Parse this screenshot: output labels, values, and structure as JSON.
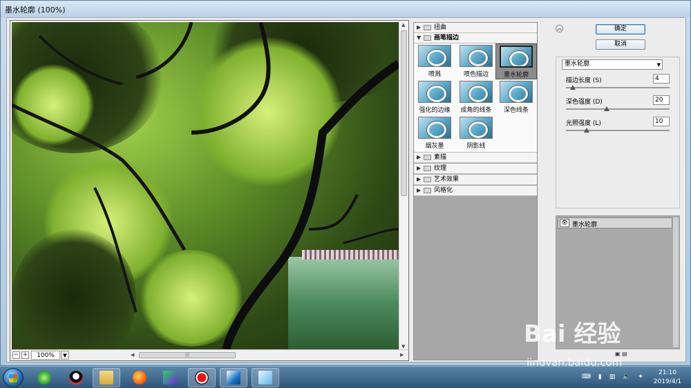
{
  "window": {
    "title": "墨水轮廓 (100%)"
  },
  "preview": {
    "zoom": "100%",
    "zoom_minus": "−",
    "zoom_plus": "+",
    "grip": "|||"
  },
  "gallery": {
    "categories_top": [
      {
        "label": "扭曲"
      }
    ],
    "open_category": {
      "label": "画笔描边"
    },
    "filters": [
      {
        "label": "喷溅"
      },
      {
        "label": "喷色描边"
      },
      {
        "label": "墨水轮廓"
      },
      {
        "label": "强化的边缘"
      },
      {
        "label": "成角的线条"
      },
      {
        "label": "深色线条"
      },
      {
        "label": "烟灰墨"
      },
      {
        "label": "阴影线"
      }
    ],
    "categories_bottom": [
      {
        "label": "素描"
      },
      {
        "label": "纹理"
      },
      {
        "label": "艺术效果"
      },
      {
        "label": "风格化"
      }
    ]
  },
  "buttons": {
    "ok": "确定",
    "cancel": "取消"
  },
  "settings": {
    "filter_select": "墨水轮廓",
    "params": [
      {
        "label": "描边长度 (S)",
        "value": "4",
        "fraction": 0.06
      },
      {
        "label": "深色强度 (D)",
        "value": "20",
        "fraction": 0.4
      },
      {
        "label": "光照强度 (L)",
        "value": "10",
        "fraction": 0.2
      }
    ]
  },
  "layers": {
    "items": [
      {
        "name": "墨水轮廓"
      }
    ]
  },
  "taskbar": {
    "time": "21:10",
    "date": "2019/4/1"
  },
  "watermark": {
    "brand": "Bai 经验",
    "url": "jingyan.baidu.com"
  }
}
